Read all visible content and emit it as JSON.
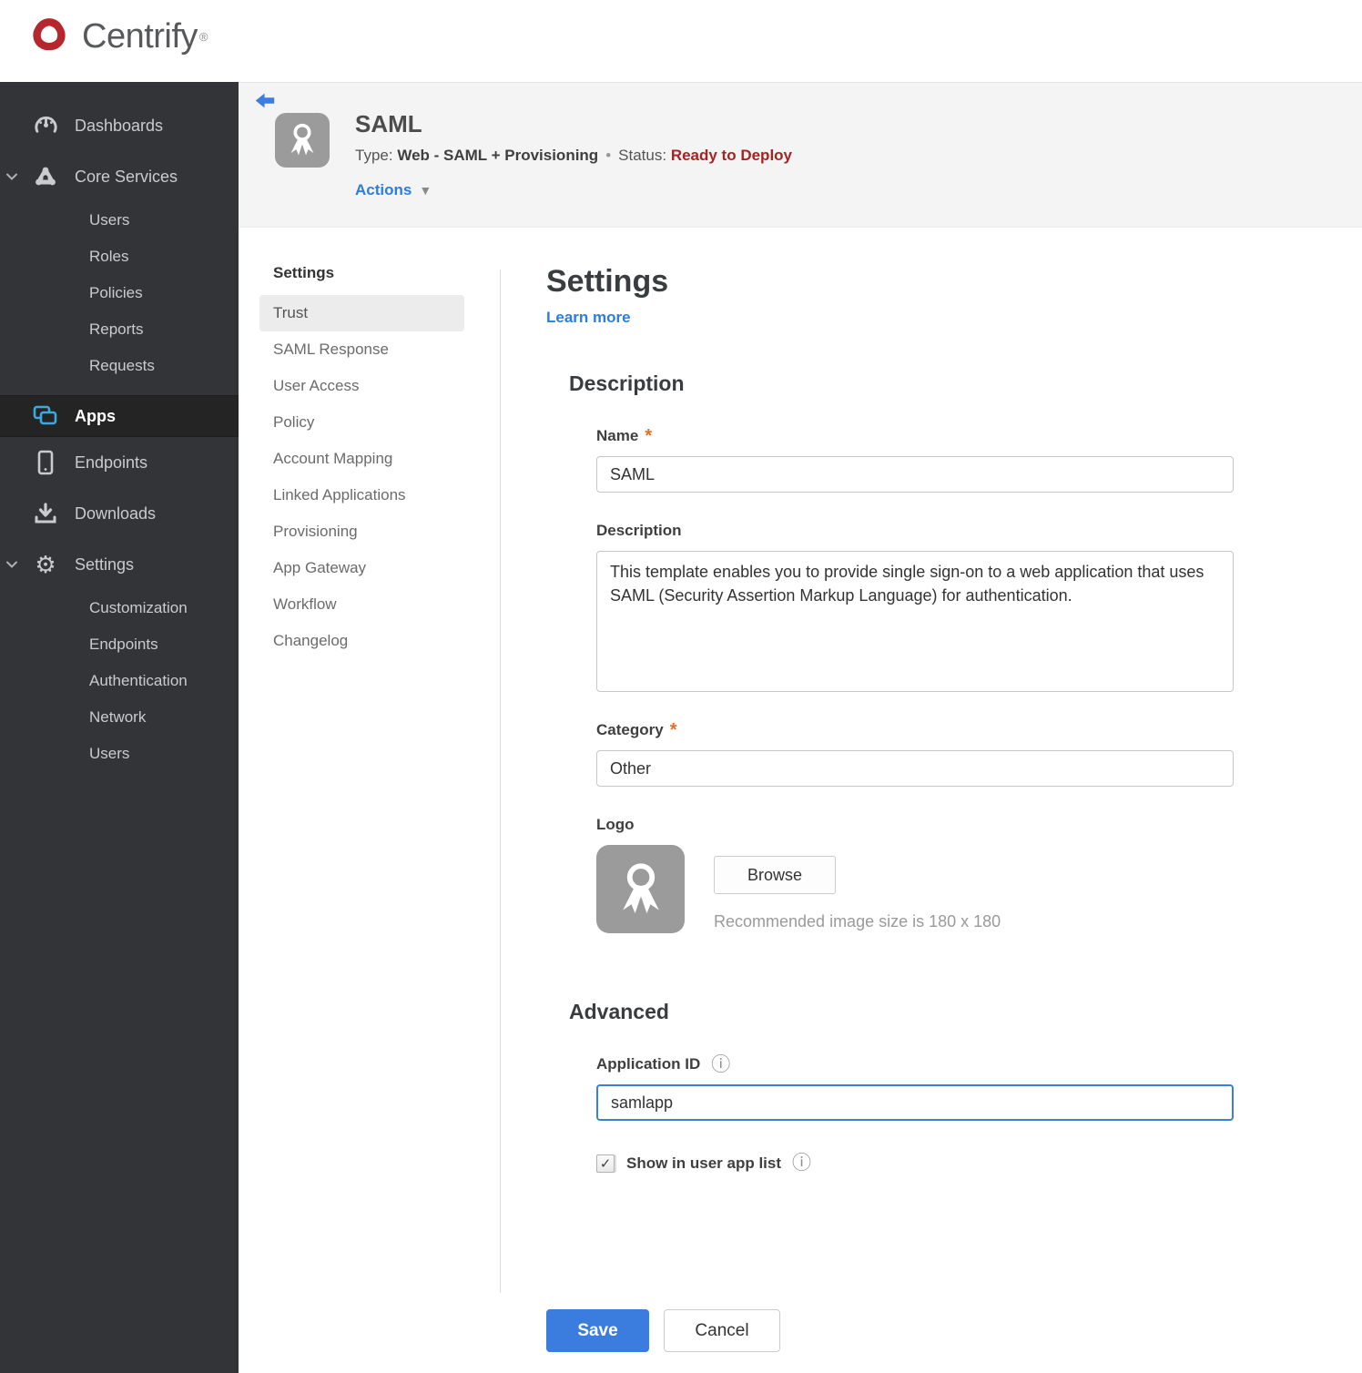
{
  "brand": {
    "name": "Centrify",
    "trademark": "®"
  },
  "icons": {
    "gear": "⚙",
    "info": "ⓘ",
    "check": "✓",
    "caret_down": "▼"
  },
  "colors": {
    "sidebar_bg": "#323437",
    "accent_blue": "#2b7de1",
    "apps_icon_blue": "#3aa9e0",
    "status_red": "#a32422",
    "required_orange": "#ef6c1a",
    "save_blue": "#3a7dde",
    "logo_gray": "#9b9b9b"
  },
  "sidebar": {
    "dashboards": "Dashboards",
    "core_services": "Core Services",
    "core_sub": [
      "Users",
      "Roles",
      "Policies",
      "Reports",
      "Requests"
    ],
    "apps": "Apps",
    "endpoints": "Endpoints",
    "downloads": "Downloads",
    "settings": "Settings",
    "settings_sub": [
      "Customization",
      "Endpoints",
      "Authentication",
      "Network",
      "Users"
    ]
  },
  "header": {
    "app_title": "SAML",
    "type_label": "Type:",
    "type_value": "Web - SAML + Provisioning",
    "separator": "•",
    "status_label": "Status:",
    "status_value": "Ready to Deploy",
    "actions_label": "Actions"
  },
  "subnav": {
    "heading": "Settings",
    "selected": "Trust",
    "items": [
      "Trust",
      "SAML Response",
      "User Access",
      "Policy",
      "Account Mapping",
      "Linked Applications",
      "Provisioning",
      "App Gateway",
      "Workflow",
      "Changelog"
    ]
  },
  "main": {
    "heading": "Settings",
    "learn_more": "Learn more",
    "description_section": "Description",
    "name_label": "Name",
    "required_marker": "*",
    "name_value": "SAML",
    "description_label": "Description",
    "description_value": "This template enables you to provide single sign-on to a web application that uses SAML (Security Assertion Markup Language) for authentication.",
    "category_label": "Category",
    "category_value": "Other",
    "logo_label": "Logo",
    "browse_label": "Browse",
    "logo_hint": "Recommended image size is 180 x 180",
    "advanced_section": "Advanced",
    "application_id_label": "Application ID",
    "application_id_value": "samlapp",
    "show_in_app_list_label": "Show in user app list",
    "show_in_app_list_checked": true,
    "save_label": "Save",
    "cancel_label": "Cancel"
  }
}
